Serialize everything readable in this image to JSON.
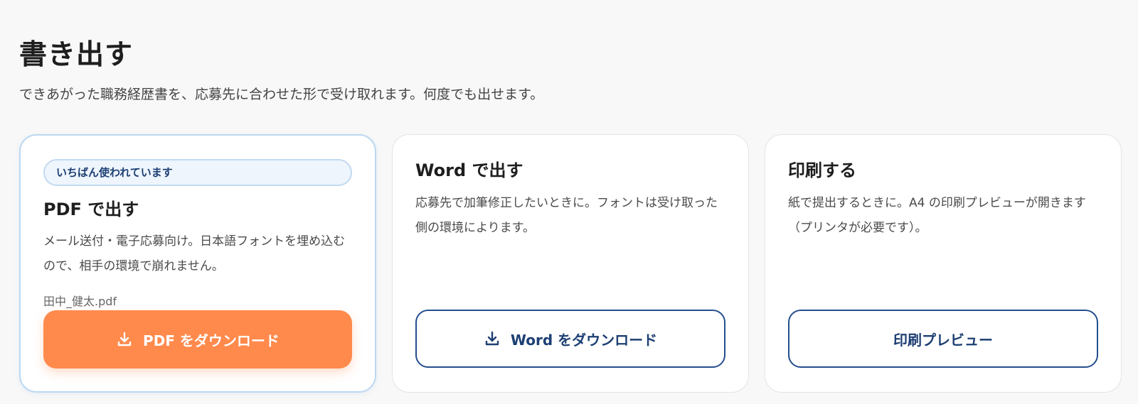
{
  "header": {
    "title": "書き出す",
    "subtitle": "できあがった職務経歴書を、応募先に合わせた形で受け取れます。何度でも出せます。"
  },
  "cards": [
    {
      "badge": "いちばん使われています",
      "title": "PDF で出す",
      "description": "メール送付・電子応募向け。日本語フォントを埋め込むので、相手の環境で崩れません。",
      "filename": "田中_健太.pdf",
      "button_label": "PDF をダウンロード",
      "button_icon": "download-icon",
      "button_color": "#ff8a4c"
    },
    {
      "title": "Word で出す",
      "description": "応募先で加筆修正したいときに。フォントは受け取った側の環境によります。",
      "button_label": "Word をダウンロード",
      "button_icon": "download-icon",
      "button_color": "#254e8f"
    },
    {
      "title": "印刷する",
      "description": "紙で提出するときに。A4 の印刷プレビューが開きます（プリンタが必要です）。",
      "button_label": "印刷プレビュー",
      "button_color": "#254e8f"
    }
  ]
}
